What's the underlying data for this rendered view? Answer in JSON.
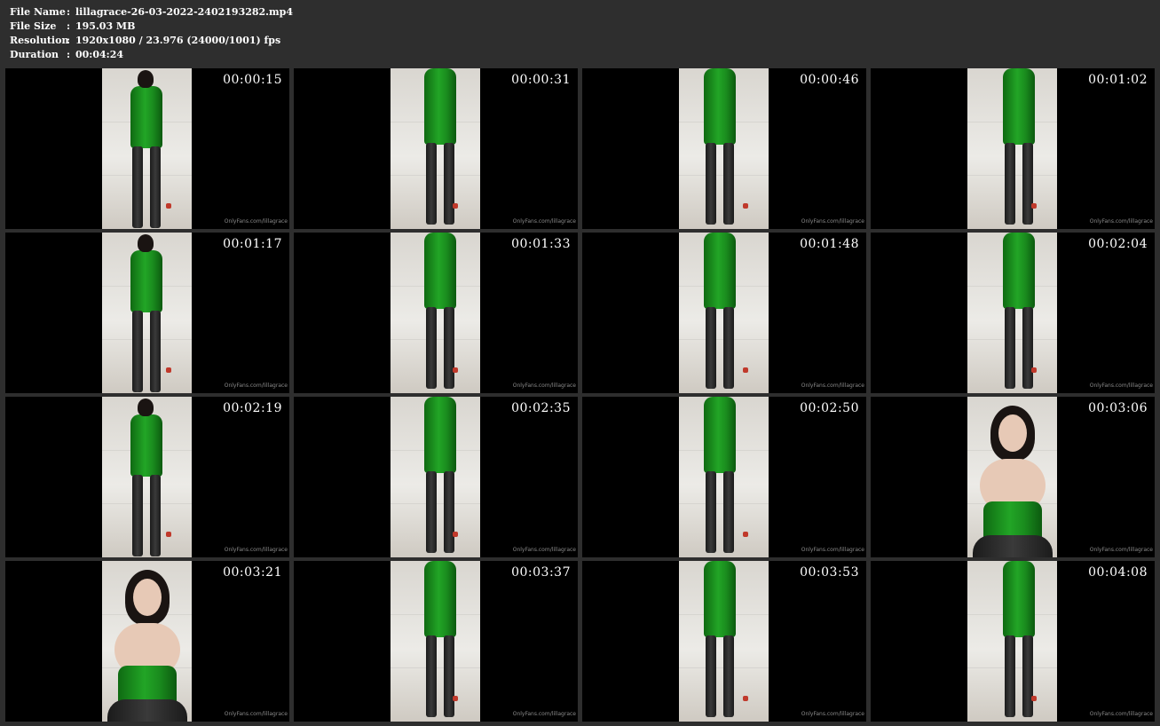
{
  "info": [
    {
      "key": "File Name",
      "sep": ":",
      "value": "lillagrace-26-03-2022-2402193282.mp4"
    },
    {
      "key": "File Size",
      "sep": ":",
      "value": "195.03 MB"
    },
    {
      "key": "Resolution",
      "sep": ":",
      "value": "1920x1080 / 23.976 (24000/1001) fps"
    },
    {
      "key": "Duration",
      "sep": ":",
      "value": "00:04:24"
    }
  ],
  "thumbnails": [
    {
      "time": "00:00:15",
      "watermark": "OnlyFans.com/lillagrace"
    },
    {
      "time": "00:00:31",
      "watermark": "OnlyFans.com/lillagrace"
    },
    {
      "time": "00:00:46",
      "watermark": "OnlyFans.com/lillagrace"
    },
    {
      "time": "00:01:02",
      "watermark": "OnlyFans.com/lillagrace"
    },
    {
      "time": "00:01:17",
      "watermark": "OnlyFans.com/lillagrace"
    },
    {
      "time": "00:01:33",
      "watermark": "OnlyFans.com/lillagrace"
    },
    {
      "time": "00:01:48",
      "watermark": "OnlyFans.com/lillagrace"
    },
    {
      "time": "00:02:04",
      "watermark": "OnlyFans.com/lillagrace"
    },
    {
      "time": "00:02:19",
      "watermark": "OnlyFans.com/lillagrace"
    },
    {
      "time": "00:02:35",
      "watermark": "OnlyFans.com/lillagrace"
    },
    {
      "time": "00:02:50",
      "watermark": "OnlyFans.com/lillagrace"
    },
    {
      "time": "00:03:06",
      "watermark": "OnlyFans.com/lillagrace"
    },
    {
      "time": "00:03:21",
      "watermark": "OnlyFans.com/lillagrace"
    },
    {
      "time": "00:03:37",
      "watermark": "OnlyFans.com/lillagrace"
    },
    {
      "time": "00:03:53",
      "watermark": "OnlyFans.com/lillagrace"
    },
    {
      "time": "00:04:08",
      "watermark": "OnlyFans.com/lillagrace"
    }
  ],
  "colors": {
    "background": "#2e2e2e",
    "thumb_background": "#000000",
    "text": "#ffffff",
    "dress": "#22a526",
    "watermark": "#8a8a8a"
  }
}
